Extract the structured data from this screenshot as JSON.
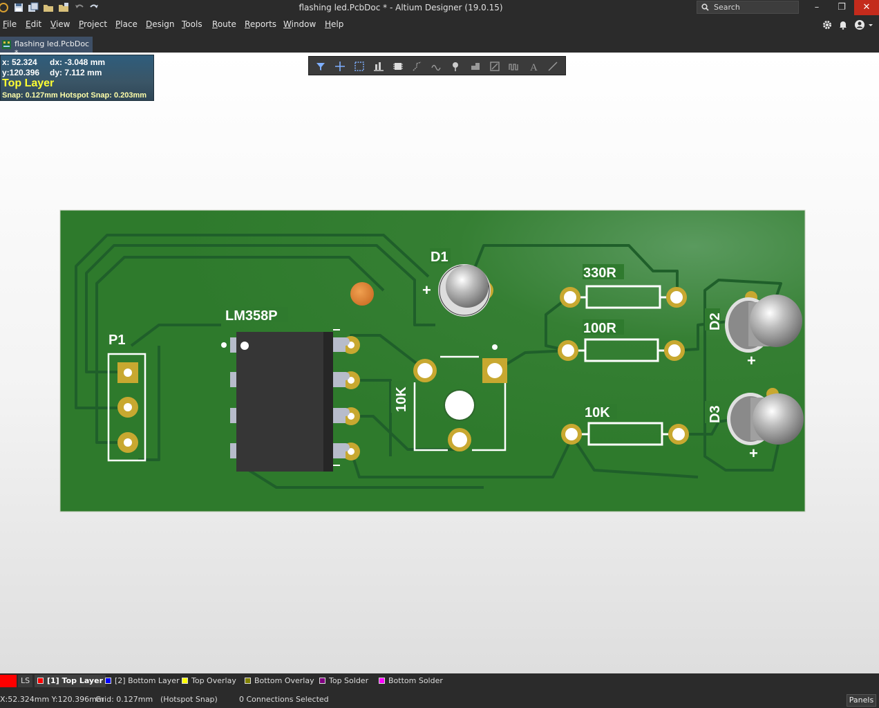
{
  "window": {
    "title": "flashing led.PcbDoc * - Altium Designer (19.0.15)",
    "search_placeholder": "Search",
    "minimize": "–",
    "restore": "❐",
    "close": "✕"
  },
  "menu": [
    "File",
    "Edit",
    "View",
    "Project",
    "Place",
    "Design",
    "Tools",
    "Route",
    "Reports",
    "Window",
    "Help"
  ],
  "document_tab": "flashing led.PcbDoc *",
  "hud": {
    "x": "x: 52.324",
    "dx": "dx: -3.048 mm",
    "y": "y:120.396",
    "dy": "dy:  7.112 mm",
    "layer": "Top Layer",
    "snap": "Snap: 0.127mm Hotspot Snap: 0.203mm"
  },
  "pcb": {
    "designators": {
      "p1": "P1",
      "u1": "LM358P",
      "d1": "D1",
      "pot": "10K",
      "r1": "330R",
      "r2": "100R",
      "r3": "10K",
      "d2": "D2",
      "d3": "D3"
    },
    "plus": "+",
    "colors": {
      "board": "#2e7d2e",
      "trace": "#1f5f2a",
      "silkscreen": "#ffffff",
      "pad": "#c8a830",
      "body": "#3a3a3a"
    }
  },
  "layers": {
    "ls": "LS",
    "tabs": [
      {
        "label": "[1] Top Layer",
        "color": "#ff0000"
      },
      {
        "label": "[2] Bottom Layer",
        "color": "#0000ff"
      },
      {
        "label": "Top Overlay",
        "color": "#ffff00"
      },
      {
        "label": "Bottom Overlay",
        "color": "#808000"
      },
      {
        "label": "Top Solder",
        "color": "#800080"
      },
      {
        "label": "Bottom Solder",
        "color": "#ff00ff"
      }
    ]
  },
  "status": {
    "coords": "X:52.324mm Y:120.396mm",
    "grid": "Grid: 0.127mm",
    "snap": "(Hotspot Snap)",
    "connections": "0 Connections Selected",
    "panels": "Panels"
  }
}
